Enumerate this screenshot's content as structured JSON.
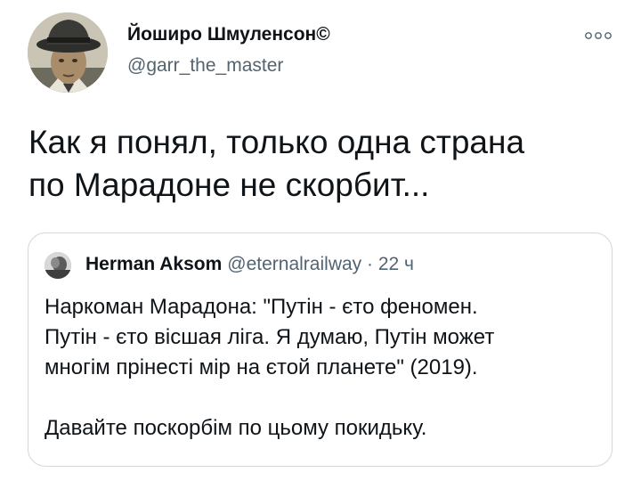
{
  "tweet": {
    "author_name": "Йоширо Шмуленсон©",
    "author_handle": "@garr_the_master",
    "text": "Как я понял, только одна страна\nпо Марадоне не скорбит...",
    "more_icon": "more-options-icon"
  },
  "quoted_tweet": {
    "author_name": "Herman Aksom",
    "meta": "@eternalrailway · 22 ч",
    "text": "Наркоман Марадона: \"Путін - єто феномен.\nПутін - єто вісшая ліга. Я думаю, Путін может\nмногім прінесті мір на єтой планете\" (2019).\n\nДавайте поскорбім по цьому покидьку."
  },
  "colors": {
    "text_primary": "#0f1419",
    "text_secondary": "#536471",
    "border": "#cfd9de",
    "background": "#ffffff"
  }
}
